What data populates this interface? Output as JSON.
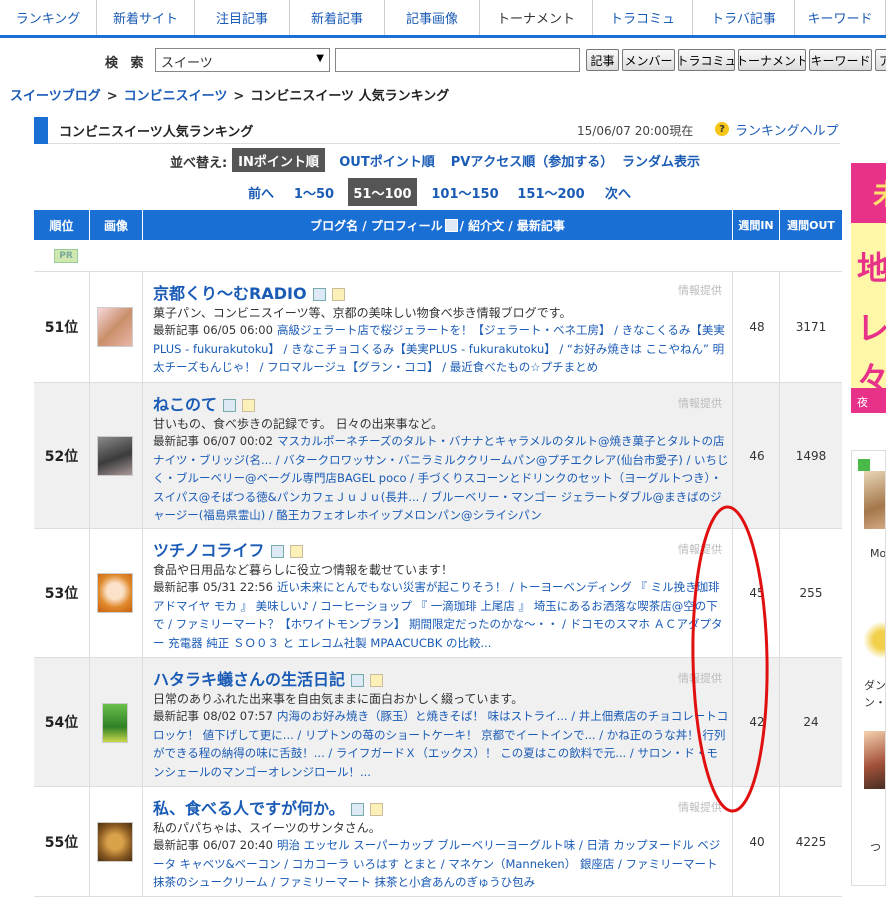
{
  "nav": {
    "tabs": [
      "ランキング",
      "新着サイト",
      "注目記事",
      "新着記事",
      "記事画像",
      "トーナメント",
      "トラコミュ",
      "トラバ記事",
      "キーワード"
    ]
  },
  "search": {
    "label": "検 索",
    "selected": "スイーツ",
    "input_value": "",
    "buttons": [
      "記事",
      "メンバー",
      "トラコミュ",
      "トーナメント",
      "キーワード",
      "ア"
    ]
  },
  "breadcrumb": [
    "スイーツブログ",
    "コンビニスイーツ",
    "コンビニスイーツ 人気ランキング"
  ],
  "ranking": {
    "title": "コンビニスイーツ人気ランキング",
    "updated": "15/06/07 20:00現在",
    "help": "ランキングヘルプ",
    "sort_label": "並べ替え:",
    "sort_options": [
      "INポイント順",
      "OUTポイント順",
      "PVアクセス順（参加する）",
      "ランダム表示"
    ],
    "pager": [
      "前へ",
      "1～50",
      "51～100",
      "101～150",
      "151～200",
      "次へ"
    ],
    "columns": [
      "順位",
      "画像",
      "ブログ名 / プロフィール",
      "/ 紹介文 / 最新記事",
      "週間IN",
      "週間OUT"
    ],
    "pr": "PR",
    "provided": "情報提供",
    "latest_label": "最新記事",
    "rows": [
      {
        "rank": "51位",
        "name": "京都くり～むRADIO",
        "desc": "菓子パン、コンビニスイーツ等、京都の美味しい物食べ歩き情報ブログです。",
        "time": "06/05 06:00",
        "articles": "高級ジェラート店で桜ジェラートを！【ジェラート・ベネ工房】 / きなこくるみ【美実PLUS - fukurakutoku】 / きなこチョコくるみ【美実PLUS - fukurakutoku】 / “お好み焼きは ここやねん” 明太チーズもんじゃ！ / フロマルージュ【グラン・ココ】 / 最近食べたもの☆プチまとめ",
        "in": "48",
        "out": "3171"
      },
      {
        "rank": "52位",
        "name": "ねこのて",
        "desc": "甘いもの、食べ歩きの記録です。 日々の出来事など。",
        "time": "06/07 00:02",
        "articles": "マスカルポーネチーズのタルト・バナナとキャラメルのタルト@焼き菓子とタルトの店 ナイツ・ブリッジ(名... / バタークロワッサン・バニラミルククリームパン@プチエクレア(仙台市愛子) / いちじく・ブルーベリー@ベーグル専門店BAGEL poco / 手づくりスコーンとドリンクのセット（ヨーグルトつき）・スイパス@そばつる徳&パンカフェＪｕＪｕ(長井... / ブルーベリー・マンゴー ジェラートダブル@まきばのジャージー(福島県霊山) / 酪王カフェオレホイップメロンパン@シライシパン",
        "in": "46",
        "out": "1498"
      },
      {
        "rank": "53位",
        "name": "ツチノコライフ",
        "desc": "食品や日用品など暮らしに役立つ情報を載せています！",
        "time": "05/31 22:56",
        "articles": "近い未来にとんでもない災害が起こりそう！ / トーヨーベンディング 『 ミル挽き珈琲アドマイヤ モカ 』 美味しい♪ / コーヒーショップ 『 一滴珈琲 上尾店 』 埼玉にあるお洒落な喫茶店@空の下で / ファミリーマート？【ホワイトモンブラン】 期間限定だったのかな～・・ / ドコモのスマホ ＡＣアダプター 充電器 純正 ＳＯ０３ と エレコム社製 MPAACUCBK の比較...",
        "in": "45",
        "out": "255"
      },
      {
        "rank": "54位",
        "name": "ハタラキ蟻さんの生活日記",
        "desc": "日常のありふれた出来事を自由気ままに面白おかしく綴っています。",
        "time": "08/02 07:57",
        "articles": "内海のお好み焼き（豚玉）と焼きそば！ 味はストライ... / 井上佃煮店のチョコレートコロッケ！ 値下げして更に... / リプトンの苺のショートケーキ！ 京都でイートインで... / かね正のうな丼！ 行列ができる程の納得の味に舌鼓！... / ライフガードＸ（エックス）！ この夏はこの飲料で元... / サロン・ド・モンシェールのマンゴーオレンジロール！...",
        "in": "42",
        "out": "24"
      },
      {
        "rank": "55位",
        "name": "私、食べる人ですが何か。",
        "desc": "私のパパちゃは、スイーツのサンタさん。",
        "time": "06/07 20:40",
        "articles": "明治 エッセル スーパーカップ ブルーベリーヨーグルト味 / 日清 カップヌードル ベジータ キャベツ&ベーコン / コカコーラ いろはす とまと / マネケン（Manneken） 銀座店 / ファミリーマート 抹茶のシュークリーム / ファミリーマート 抹茶と小倉あんのぎゅうひ包み",
        "in": "40",
        "out": "4225"
      }
    ]
  },
  "side": {
    "banner": [
      "未",
      "地",
      "レ",
      "々",
      "夜"
    ],
    "captions": [
      "Mo",
      "ダン",
      "ン・",
      "つ"
    ]
  },
  "colors": {
    "accent": "#1a6fd4",
    "link": "#1a5bb5",
    "annotation": "#e01010"
  }
}
